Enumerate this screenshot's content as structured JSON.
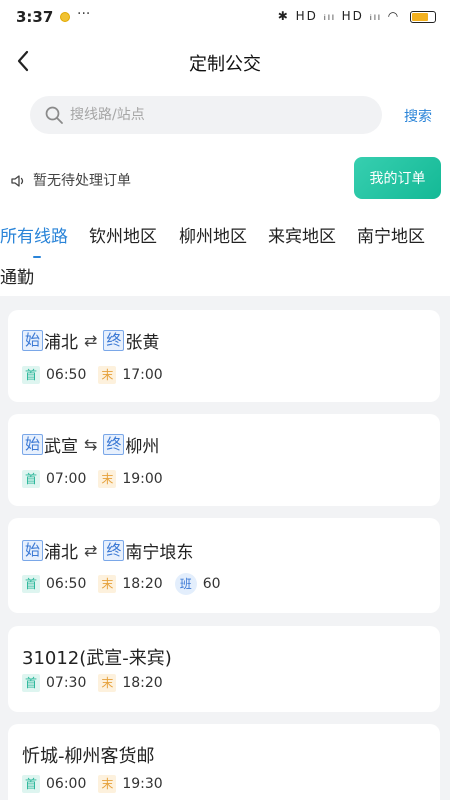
{
  "status_bar": {
    "time": "3:37",
    "more": "···",
    "network": "HD ᵢₗₗ HD ᵢₗₗ",
    "battery": "50"
  },
  "header": {
    "title": "定制公交"
  },
  "search": {
    "placeholder": "搜线路/站点",
    "button": "搜索"
  },
  "notice": {
    "text": "暂无待处理订单",
    "my_orders": "我的订单"
  },
  "tabs": [
    "所有线路",
    "钦州地区",
    "柳州地区",
    "来宾地区",
    "南宁地区",
    "通勤"
  ],
  "badges": {
    "start": "始",
    "end": "终",
    "first": "首",
    "last": "末",
    "shift": "班"
  },
  "colors": {
    "accent_blue": "#2a84d8",
    "accent_green": "#14b996",
    "first_badge": "#27b699",
    "last_badge": "#e6a23c"
  },
  "routes": [
    {
      "from": "浦北",
      "arrow": "⇄",
      "to": "张黄",
      "first": "06:50",
      "last": "17:00"
    },
    {
      "from": "武宣",
      "arrow": "⇆",
      "to": "柳州",
      "first": "07:00",
      "last": "19:00"
    },
    {
      "from": "浦北",
      "arrow": "⇄",
      "to": "南宁埌东",
      "first": "06:50",
      "last": "18:20",
      "shift": "60"
    },
    {
      "name": "31012(武宣-来宾)",
      "first": "07:30",
      "last": "18:20"
    },
    {
      "name": "忻城-柳州客货邮",
      "first": "06:00",
      "last": "19:30"
    }
  ]
}
